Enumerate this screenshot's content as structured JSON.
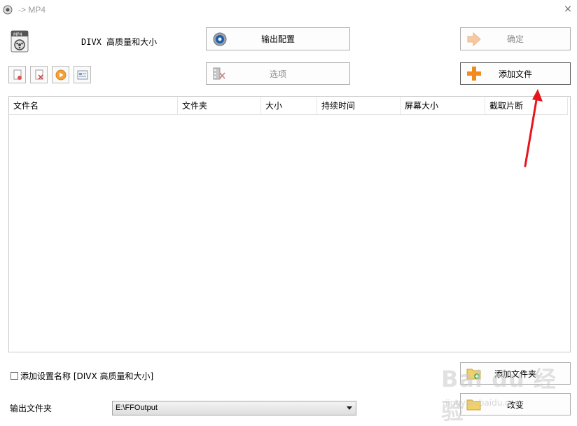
{
  "window": {
    "title": "-> MP4",
    "close_glyph": "×"
  },
  "preset": {
    "label": "DIVX 高质量和大小"
  },
  "buttons": {
    "output_config": "输出配置",
    "options": "选项",
    "ok": "确定",
    "add_file": "添加文件",
    "add_folder": "添加文件夹",
    "change": "改变"
  },
  "toolbar_small": [
    {
      "icon": "remove-file-icon"
    },
    {
      "icon": "clear-list-icon"
    },
    {
      "icon": "play-icon"
    },
    {
      "icon": "media-info-icon"
    }
  ],
  "table": {
    "columns": [
      "文件名",
      "文件夹",
      "大小",
      "持续时间",
      "屏幕大小",
      "截取片断"
    ],
    "rows": []
  },
  "bottom": {
    "add_setting_name_label": "添加设置名称 [DIVX 高质量和大小]",
    "add_setting_name_checked": false,
    "output_folder_label": "输出文件夹",
    "output_folder_value": "E:\\FFOutput"
  },
  "watermark": {
    "brand": "Bai du 经验",
    "url": "jingyan.baidu.com"
  },
  "colors": {
    "accent_orange": "#f28a1e",
    "annotation_red": "#e8141b",
    "border": "#adadad"
  }
}
